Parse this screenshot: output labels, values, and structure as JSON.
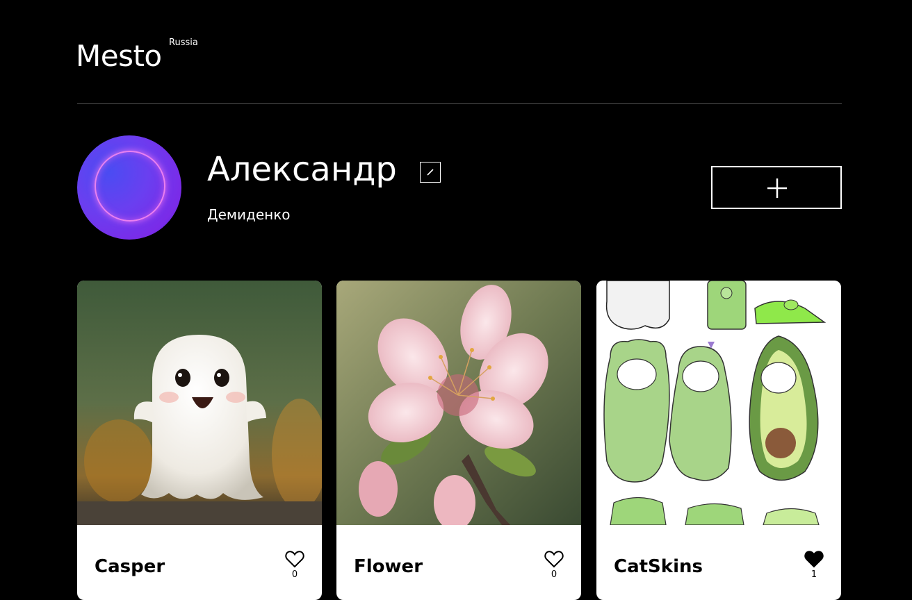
{
  "header": {
    "logo": "Mesto",
    "logo_sup": "Russia"
  },
  "profile": {
    "name": "Александр",
    "about": "Демиденко"
  },
  "cards": [
    {
      "title": "Casper",
      "likes": "0",
      "liked": false
    },
    {
      "title": "Flower",
      "likes": "0",
      "liked": false
    },
    {
      "title": "CatSkins",
      "likes": "1",
      "liked": true
    }
  ],
  "colors": {
    "background": "#000000",
    "card": "#ffffff",
    "divider": "#545454"
  }
}
